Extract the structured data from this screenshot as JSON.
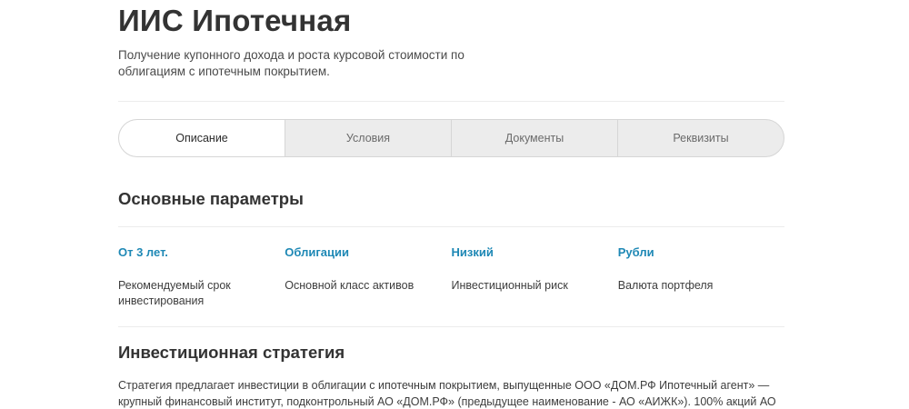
{
  "header": {
    "title": "ИИС Ипотечная",
    "subtitle": "Получение купонного дохода и роста курсовой стоимости по облигациям с ипотечным покрытием."
  },
  "tabs": [
    {
      "label": "Описание",
      "active": true
    },
    {
      "label": "Условия",
      "active": false
    },
    {
      "label": "Документы",
      "active": false
    },
    {
      "label": "Реквизиты",
      "active": false
    }
  ],
  "main_params": {
    "title": "Основные параметры",
    "items": [
      {
        "value": "От 3 лет.",
        "label": "Рекомендуемый срок инвестирования"
      },
      {
        "value": "Облигации",
        "label": "Основной класс активов"
      },
      {
        "value": "Низкий",
        "label": "Инвестиционный риск"
      },
      {
        "value": "Рубли",
        "label": "Валюта портфеля"
      }
    ]
  },
  "strategy": {
    "title": "Инвестиционная стратегия",
    "line1": "Стратегия предлагает инвестиции в облигации с ипотечным покрытием, выпущенные ООО «ДОМ.РФ Ипотечный агент» —",
    "line2": "крупный финансовый институт, подконтрольный АО «ДОМ.РФ» (предыдущее наименование - АО «АИЖК»). 100% акций АО"
  },
  "colors": {
    "accent": "#1e88b5",
    "tab_background": "#ececec",
    "active_tab": "#ffffff"
  }
}
